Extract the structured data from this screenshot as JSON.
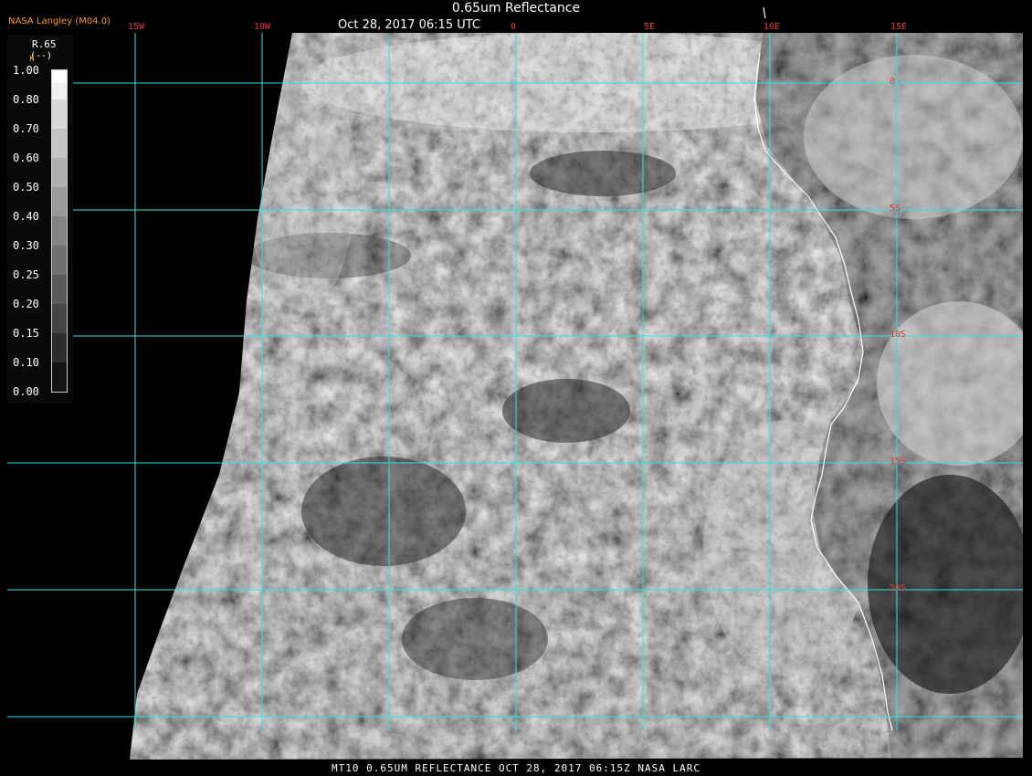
{
  "header": {
    "title": "0.65um Reflectance",
    "timestamp": "Oct 28, 2017 06:15 UTC",
    "source": "NASA Langley (M04.0)"
  },
  "legend": {
    "title": "R.65",
    "units": "(--)",
    "side_mark": "K",
    "ticks": [
      "1.00",
      "0.80",
      "0.70",
      "0.60",
      "0.50",
      "0.40",
      "0.30",
      "0.25",
      "0.20",
      "0.15",
      "0.10",
      "0.00"
    ]
  },
  "longitude_labels": [
    "15W",
    "10W",
    "0",
    "5E",
    "10E",
    "15E"
  ],
  "latitude_labels": [
    "0",
    "5S",
    "10S",
    "15S",
    "20S"
  ],
  "footer": "MT10  0.65UM REFLECTANCE   OCT 28, 2017 06:15Z   NASA LARC",
  "colors": {
    "grid": "#30e0e0",
    "coastline": "#ffffff",
    "label_red": "#e03a3a",
    "source_orange": "#ff9a1a",
    "background": "#000000"
  }
}
